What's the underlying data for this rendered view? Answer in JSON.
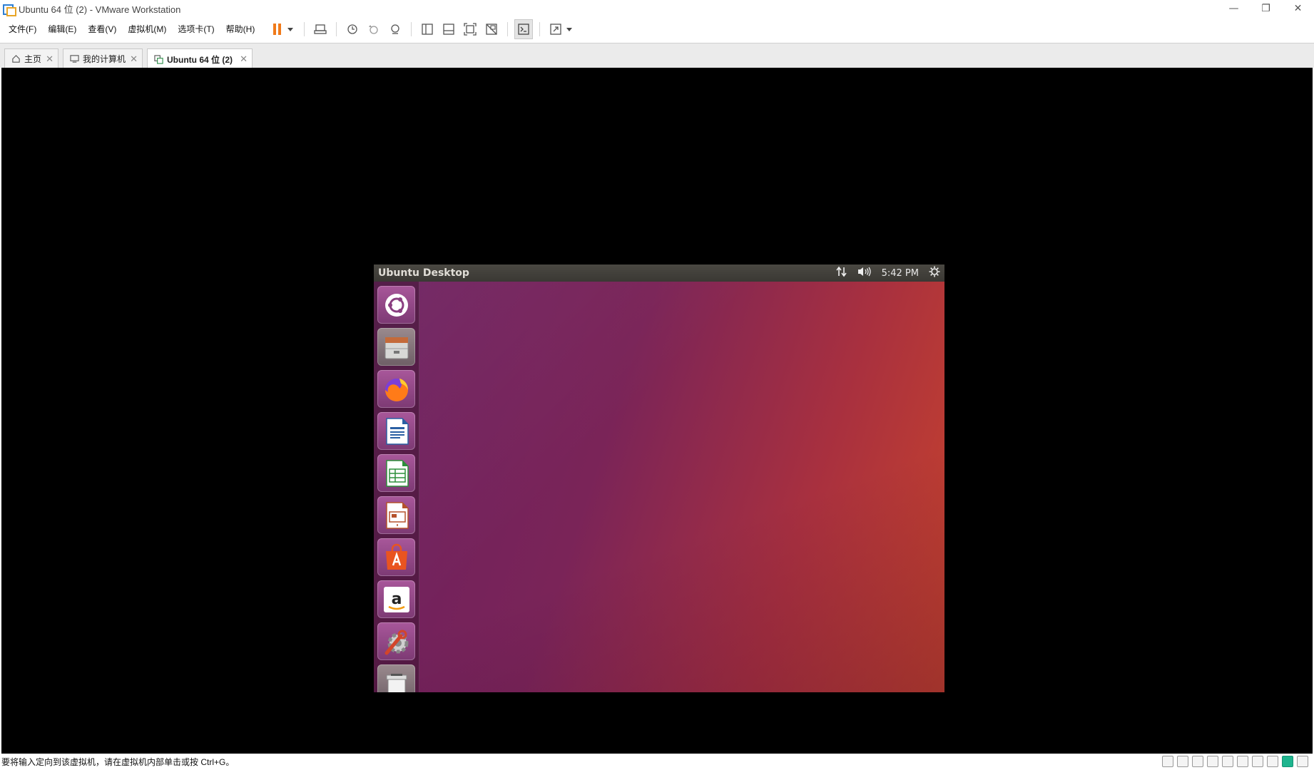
{
  "window": {
    "title": "Ubuntu 64 位 (2) - VMware Workstation",
    "minimize_glyph": "—",
    "restore_glyph": "❐",
    "close_glyph": "✕"
  },
  "menu": {
    "items": [
      "文件(F)",
      "编辑(E)",
      "查看(V)",
      "虚拟机(M)",
      "选项卡(T)",
      "帮助(H)"
    ]
  },
  "toolbar": {
    "icons": [
      "pause-icon",
      "send-ctrl-alt-del-icon",
      "snapshot-icon",
      "revert-snapshot-icon",
      "snapshot-manager-icon",
      "show-library-icon",
      "thumbnail-bar-icon",
      "full-screen-icon",
      "unity-icon",
      "console-view-icon",
      "stretch-guest-icon"
    ],
    "accent_color": "#f07a1a"
  },
  "tabs": [
    {
      "label": "主页",
      "icon": "home-icon",
      "active": false
    },
    {
      "label": "我的计算机",
      "icon": "computer-icon",
      "active": false
    },
    {
      "label": "Ubuntu 64 位 (2)",
      "icon": "vm-icon",
      "active": true
    }
  ],
  "tab_close_glyph": "✕",
  "guest": {
    "panel_title": "Ubuntu Desktop",
    "clock": "5:42 PM",
    "indicators": [
      "network-icon",
      "volume-icon",
      "settings-gear-icon"
    ],
    "launcher": [
      "ubuntu-dash-icon",
      "files-icon",
      "firefox-icon",
      "libreoffice-writer-icon",
      "libreoffice-calc-icon",
      "libreoffice-impress-icon",
      "ubuntu-software-icon",
      "amazon-icon",
      "system-settings-icon",
      "trash-icon"
    ]
  },
  "status": {
    "message": "要将输入定向到该虚拟机，请在虚拟机内部单击或按 Ctrl+G。"
  }
}
